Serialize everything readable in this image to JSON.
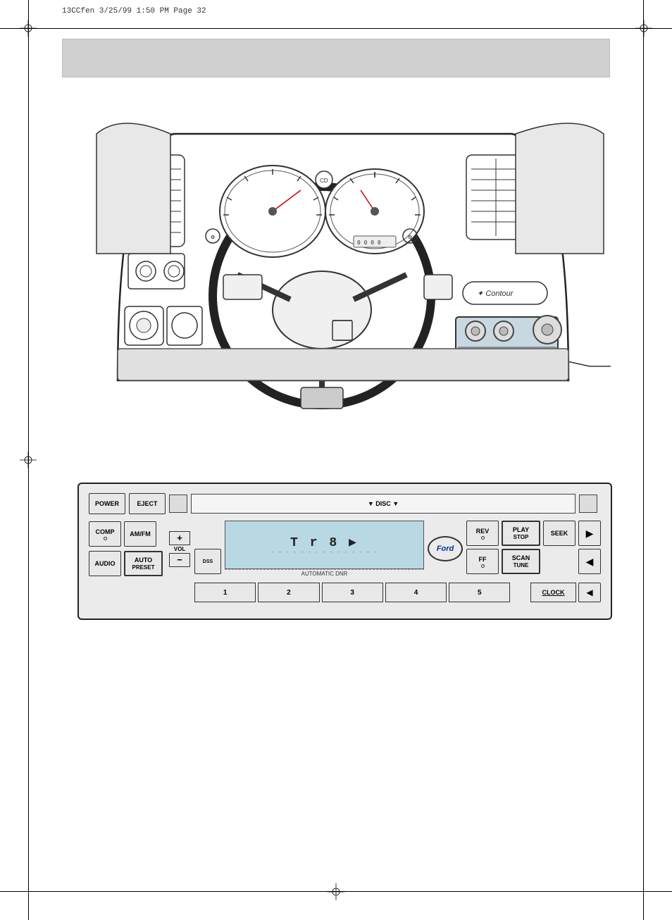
{
  "page": {
    "header_text": "13CCfen   3/25/99   1:50 PM    Page 32",
    "page_number": "32"
  },
  "radio": {
    "power_label": "POWER",
    "eject_label": "EJECT",
    "disc_label": "▼ DISC ▼",
    "comp_label": "COMP",
    "amfm_label": "AM/FM",
    "display_text": "T r  8 ▶",
    "display_dots": "- - - - - - · - - - - - - - -",
    "vol_plus": "+",
    "vol_label": "VOL",
    "vol_minus": "−",
    "audio_label": "AUDIO",
    "auto_label": "AUTO",
    "preset_label": "PRESET",
    "dss_label": "DSS",
    "automatic_dnr": "AUTOMATIC DNR",
    "ford_label": "Ford",
    "rev_label": "REV",
    "ff_label": "FF",
    "play_label": "PLAY",
    "stop_label": "STOP",
    "scan_label": "SCAN",
    "tune_label": "TUNE",
    "seek_label": "SEEK",
    "clock_label": "CLOCK",
    "preset_1": "1",
    "preset_2": "2",
    "preset_3": "3",
    "preset_4": "4",
    "preset_5": "5",
    "arrow_right_1": "▶",
    "arrow_right_2": "◀",
    "contour_label": "✦ Contour"
  }
}
